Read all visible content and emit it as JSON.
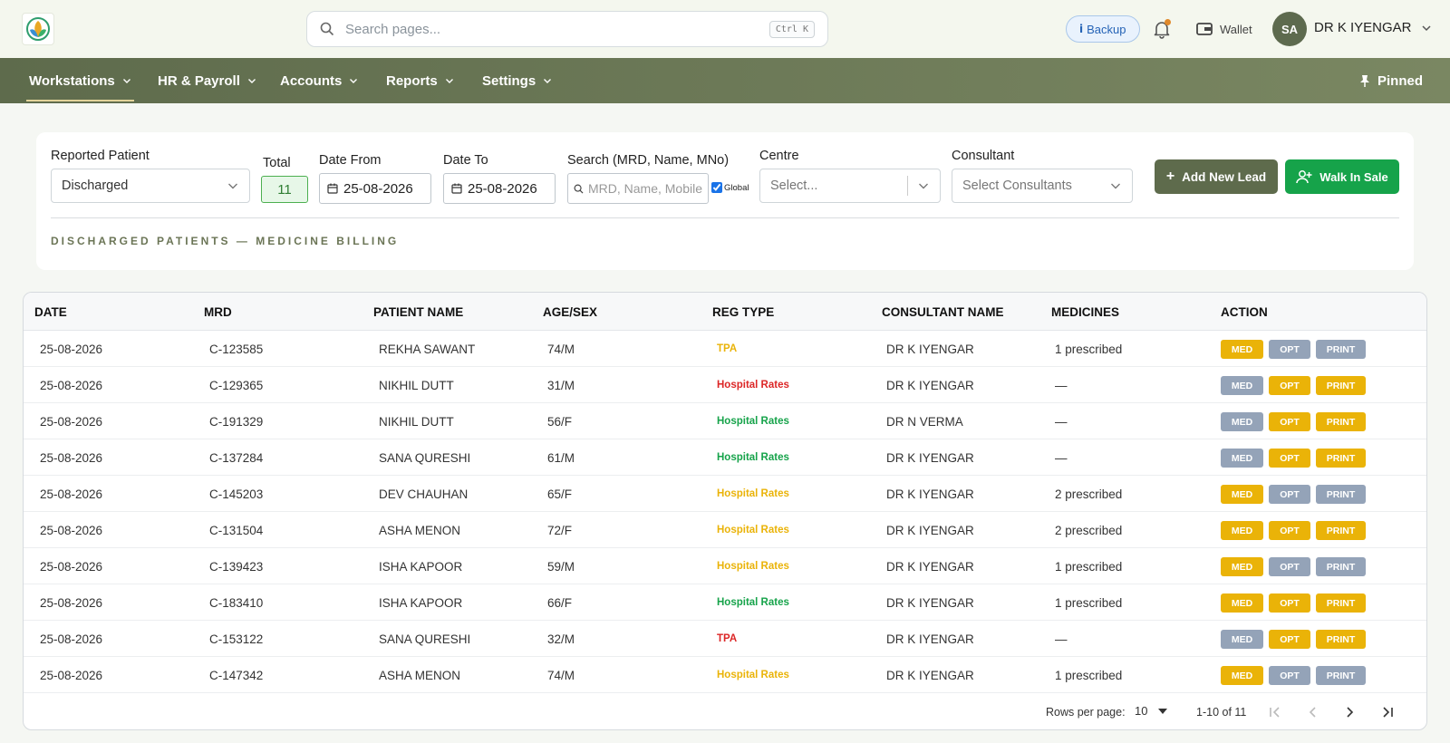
{
  "header": {
    "search_placeholder": "Search pages...",
    "shortcut": "Ctrl K",
    "backup_label": "Backup",
    "wallet_label": "Wallet",
    "avatar_initials": "SA",
    "user_name": "DR K IYENGAR"
  },
  "nav": {
    "items": [
      {
        "label": "Workstations"
      },
      {
        "label": "HR & Payroll"
      },
      {
        "label": "Accounts"
      },
      {
        "label": "Reports"
      },
      {
        "label": "Settings"
      }
    ],
    "pinned_label": "Pinned"
  },
  "filters": {
    "reported_patient_label": "Reported Patient",
    "reported_patient_value": "Discharged",
    "total_label": "Total",
    "total_value": "11",
    "date_from_label": "Date From",
    "date_from_value": "25-08-2026",
    "date_to_label": "Date To",
    "date_to_value": "25-08-2026",
    "search_label": "Search (MRD, Name, MNo)",
    "search_placeholder": "MRD, Name, Mobile",
    "global_label": "Global",
    "centre_label": "Centre",
    "centre_placeholder": "Select...",
    "consultant_label": "Consultant",
    "consultant_placeholder": "Select Consultants",
    "add_lead_label": "Add New Lead",
    "walk_in_label": "Walk In Sale",
    "section_title": "DISCHARGED PATIENTS — MEDICINE BILLING"
  },
  "table": {
    "headers": [
      "DATE",
      "MRD",
      "PATIENT NAME",
      "AGE/SEX",
      "REG TYPE",
      "CONSULTANT NAME",
      "MEDICINES",
      "ACTION"
    ],
    "action_labels": {
      "med": "MED",
      "opt": "OPT",
      "print": "PRINT"
    },
    "colors": {
      "tpa_yellow": "#eab308",
      "red": "#dc2626",
      "green": "#16a34a",
      "btn_active": "#eab308",
      "btn_inactive": "#94a3b8"
    },
    "rows": [
      {
        "date": "25-08-2026",
        "mrd": "C-123585",
        "name": "REKHA SAWANT",
        "age_sex": "74/M",
        "reg_type": "TPA",
        "reg_color": "#eab308",
        "consultant": "DR K IYENGAR",
        "medicines": "1 prescribed",
        "med": "y",
        "opt": "g",
        "print": "g"
      },
      {
        "date": "25-08-2026",
        "mrd": "C-129365",
        "name": "NIKHIL DUTT",
        "age_sex": "31/M",
        "reg_type": "Hospital Rates",
        "reg_color": "#dc2626",
        "consultant": "DR K IYENGAR",
        "medicines": "—",
        "med": "g",
        "opt": "y",
        "print": "y"
      },
      {
        "date": "25-08-2026",
        "mrd": "C-191329",
        "name": "NIKHIL DUTT",
        "age_sex": "56/F",
        "reg_type": "Hospital Rates",
        "reg_color": "#16a34a",
        "consultant": "DR N VERMA",
        "medicines": "—",
        "med": "g",
        "opt": "y",
        "print": "y"
      },
      {
        "date": "25-08-2026",
        "mrd": "C-137284",
        "name": "SANA QURESHI",
        "age_sex": "61/M",
        "reg_type": "Hospital Rates",
        "reg_color": "#16a34a",
        "consultant": "DR K IYENGAR",
        "medicines": "—",
        "med": "g",
        "opt": "y",
        "print": "y"
      },
      {
        "date": "25-08-2026",
        "mrd": "C-145203",
        "name": "DEV CHAUHAN",
        "age_sex": "65/F",
        "reg_type": "Hospital Rates",
        "reg_color": "#eab308",
        "consultant": "DR K IYENGAR",
        "medicines": "2 prescribed",
        "med": "y",
        "opt": "g",
        "print": "g"
      },
      {
        "date": "25-08-2026",
        "mrd": "C-131504",
        "name": "ASHA MENON",
        "age_sex": "72/F",
        "reg_type": "Hospital Rates",
        "reg_color": "#eab308",
        "consultant": "DR K IYENGAR",
        "medicines": "2 prescribed",
        "med": "y",
        "opt": "y",
        "print": "y"
      },
      {
        "date": "25-08-2026",
        "mrd": "C-139423",
        "name": "ISHA KAPOOR",
        "age_sex": "59/M",
        "reg_type": "Hospital Rates",
        "reg_color": "#eab308",
        "consultant": "DR K IYENGAR",
        "medicines": "1 prescribed",
        "med": "y",
        "opt": "g",
        "print": "g"
      },
      {
        "date": "25-08-2026",
        "mrd": "C-183410",
        "name": "ISHA KAPOOR",
        "age_sex": "66/F",
        "reg_type": "Hospital Rates",
        "reg_color": "#16a34a",
        "consultant": "DR K IYENGAR",
        "medicines": "1 prescribed",
        "med": "y",
        "opt": "y",
        "print": "y"
      },
      {
        "date": "25-08-2026",
        "mrd": "C-153122",
        "name": "SANA QURESHI",
        "age_sex": "32/M",
        "reg_type": "TPA",
        "reg_color": "#dc2626",
        "consultant": "DR K IYENGAR",
        "medicines": "—",
        "med": "g",
        "opt": "y",
        "print": "y"
      },
      {
        "date": "25-08-2026",
        "mrd": "C-147342",
        "name": "ASHA MENON",
        "age_sex": "74/M",
        "reg_type": "Hospital Rates",
        "reg_color": "#eab308",
        "consultant": "DR K IYENGAR",
        "medicines": "1 prescribed",
        "med": "y",
        "opt": "g",
        "print": "g"
      }
    ]
  },
  "pagination": {
    "rows_per_page_label": "Rows per page:",
    "rows_per_page_value": "10",
    "range_label": "1-10 of 11"
  }
}
